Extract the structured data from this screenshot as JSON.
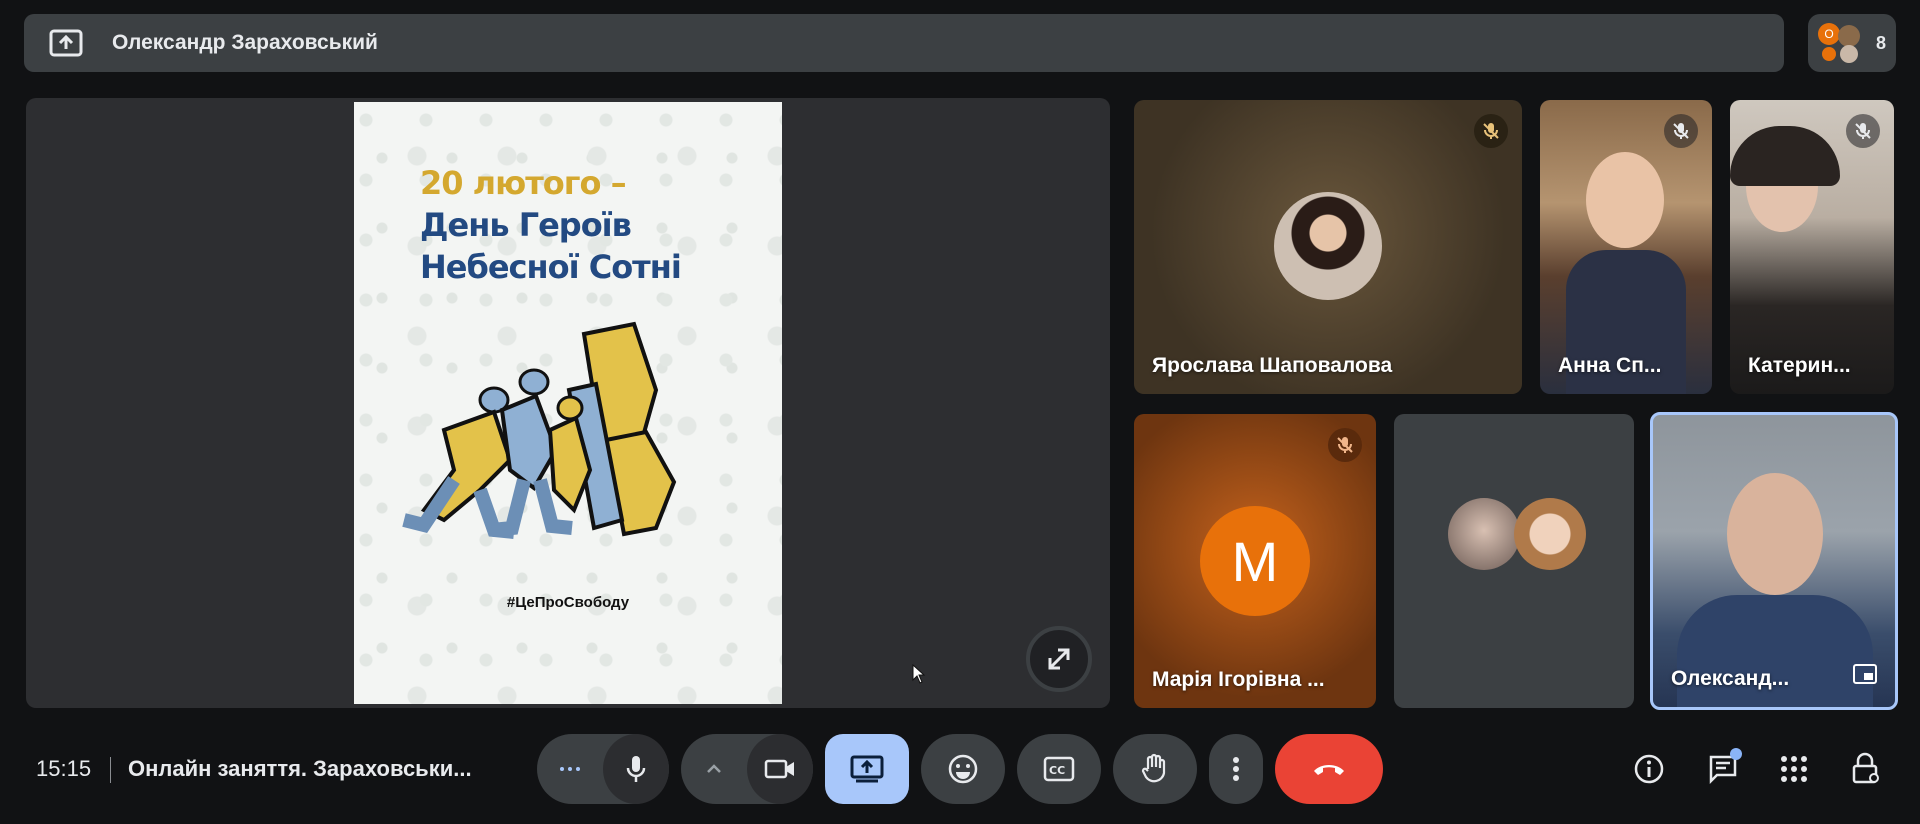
{
  "presenter_bar": {
    "presenter_name": "Олександр Зараховський",
    "present_icon": "present-to-all-icon"
  },
  "people": {
    "count": "8",
    "avatar_initial": "О"
  },
  "slide": {
    "line1": "20 лютого –",
    "line2": "День Героїв",
    "line3": "Небесної Сотні",
    "hashtag": "#ЦеПроСвободу",
    "colors": {
      "yellow": "#d4a82f",
      "blue": "#234a82"
    }
  },
  "tiles": [
    {
      "name": "Ярослава Шаповалова",
      "muted": true
    },
    {
      "name": "Анна Сп...",
      "muted": true
    },
    {
      "name": "Катерин...",
      "muted": true
    },
    {
      "name": "Марія Ігорівна ...",
      "muted": true,
      "initial": "M"
    },
    {
      "name": "",
      "muted": false
    },
    {
      "name": "Олександ...",
      "muted": false,
      "pinned_icon": "picture-in-picture-icon"
    }
  ],
  "bottom_bar": {
    "time": "15:15",
    "meeting_title": "Онлайн заняття. Зараховськи..."
  },
  "colors": {
    "accent": "#a8c7fa",
    "end_call": "#ea4335",
    "control_bg": "#3c4043",
    "background": "#111214"
  }
}
